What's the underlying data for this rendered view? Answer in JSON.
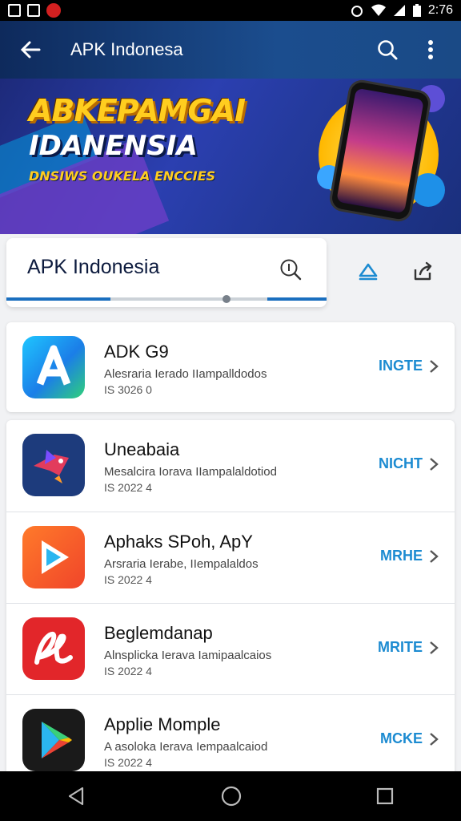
{
  "status_bar": {
    "time": "2:76"
  },
  "app_bar": {
    "title": "APK Indonesa"
  },
  "banner": {
    "headline_1": "ABKEPAMGAI",
    "headline_2": "IDANENSIA",
    "tagline": "DNSIWS OUKELA ENCCIES"
  },
  "search": {
    "value": "APK Indonesia"
  },
  "apps": [
    {
      "name": "ADK G9",
      "desc": "Alesraria Ierado IIampalldodos",
      "meta": "IS 3026 0",
      "action": "INGTE",
      "icon": "a-letter-icon"
    },
    {
      "name": "Uneabaia",
      "desc": "Mesalcira Iorava IIampalaldotiod",
      "meta": "IS 2022 4",
      "action": "NICHT",
      "icon": "bird-icon"
    },
    {
      "name": "Aphaks SPoh, ApY",
      "desc": "Arsraria Ierabe, IIempalaldos",
      "meta": "IS 2022 4",
      "action": "MRHE",
      "icon": "play-icon"
    },
    {
      "name": "Beglemdanap",
      "desc": "Alnsplicka Ierava Iamipaalcaios",
      "meta": "IS 2022 4",
      "action": "MRITE",
      "icon": "script-logo-icon"
    },
    {
      "name": "Applie Momple",
      "desc": "A asoloka Ierava Iempaalcaiod",
      "meta": "IS 2022 4",
      "action": "MCKE",
      "icon": "google-play-icon"
    }
  ],
  "colors": {
    "accent": "#1c8bd1",
    "appbar": "#163e78"
  }
}
